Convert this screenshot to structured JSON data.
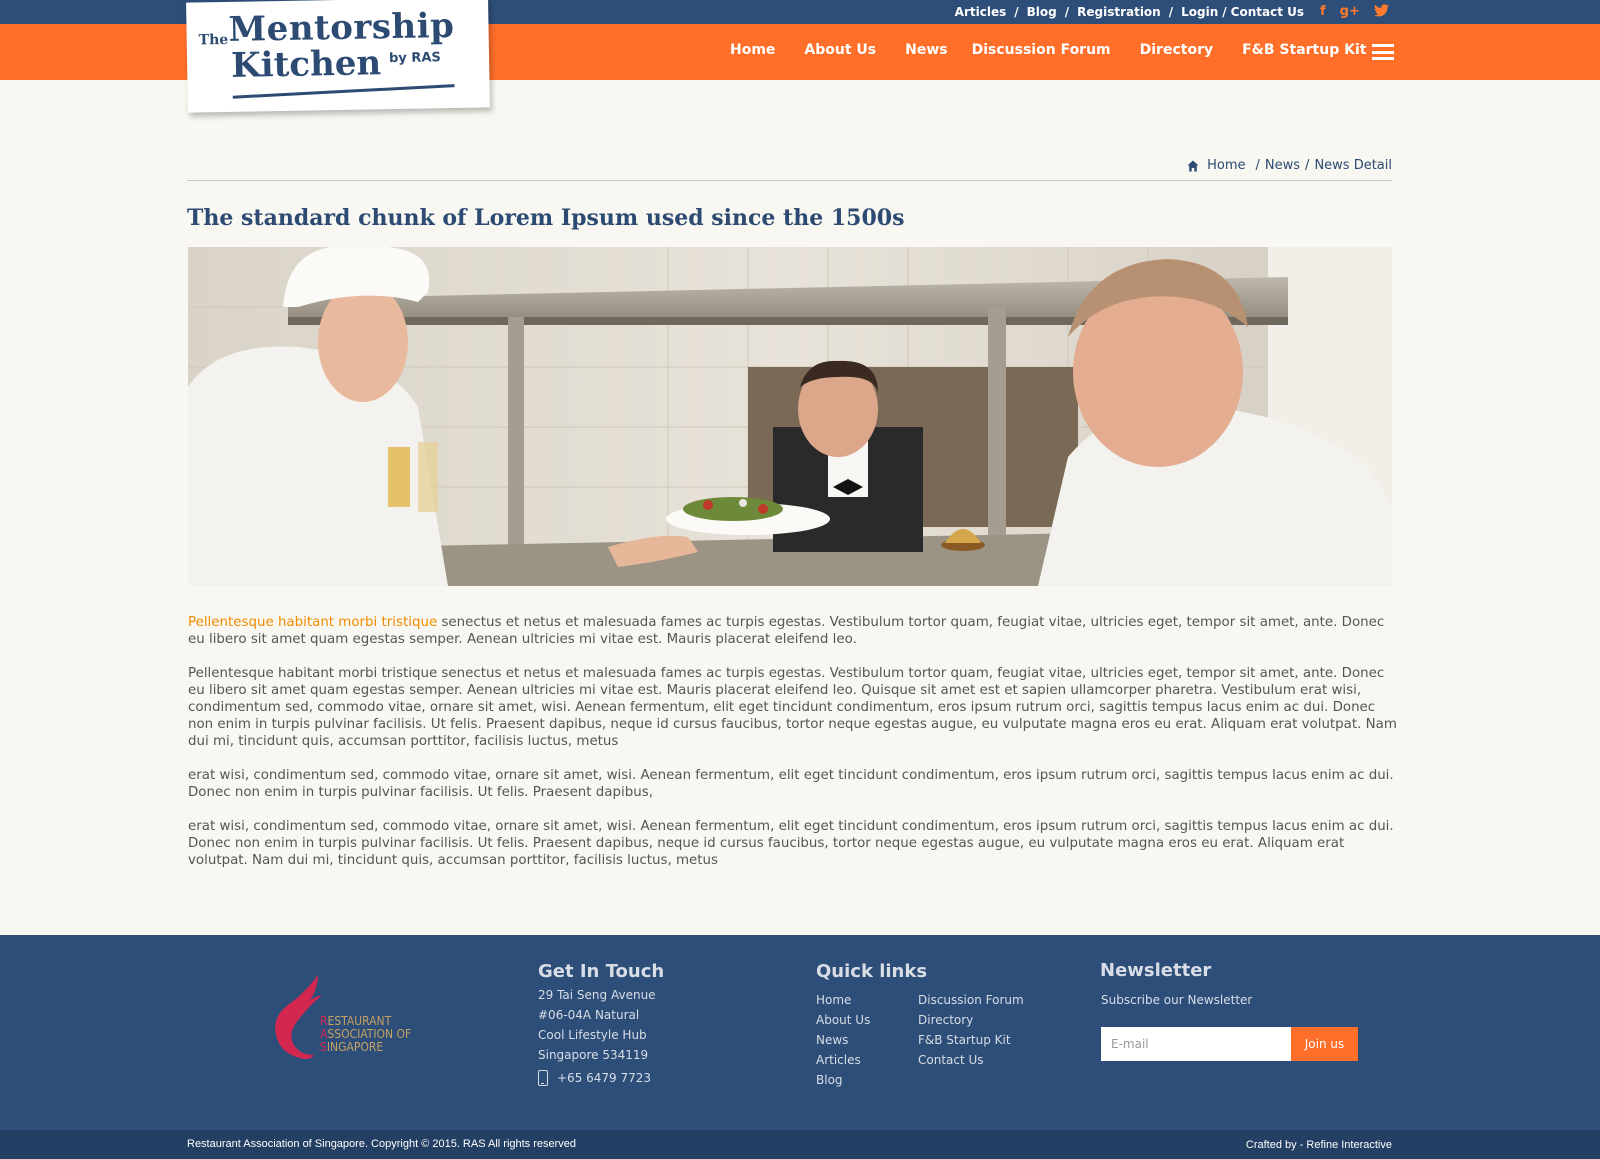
{
  "topbar": {
    "links": [
      "Articles",
      "Blog",
      "Registration",
      "Login",
      "Contact Us"
    ],
    "social": [
      {
        "icon": "facebook-icon",
        "glyph": "f"
      },
      {
        "icon": "google-plus-icon",
        "glyph": "g+"
      },
      {
        "icon": "twitter-icon",
        "glyph": "t"
      }
    ]
  },
  "logo": {
    "the": "The",
    "line1": "Mentorship",
    "line2": "Kitchen",
    "by": "by RAS"
  },
  "nav": {
    "items": [
      "Home",
      "About Us",
      "News",
      "Discussion Forum",
      "Directory",
      "F&B Startup Kit"
    ],
    "menu_icon": "hamburger-menu-icon"
  },
  "breadcrumb": {
    "home": "Home",
    "news": "News",
    "current": "News Detail"
  },
  "article": {
    "title": "The standard chunk of Lorem Ipsum used since the 1500s",
    "lead": "Pellentesque habitant morbi tristique",
    "p1_rest": " senectus et netus et malesuada fames ac turpis egestas. Vestibulum tortor quam, feugiat vitae, ultricies eget, tempor sit amet, ante. Donec eu libero sit amet quam egestas semper. Aenean ultricies mi vitae est. Mauris placerat eleifend leo.",
    "p2": "Pellentesque habitant morbi tristique senectus et netus et malesuada fames ac turpis egestas. Vestibulum tortor quam, feugiat vitae, ultricies eget, tempor sit amet, ante. Donec eu libero sit amet quam egestas semper. Aenean ultricies mi vitae est. Mauris placerat eleifend leo. Quisque sit amet est et sapien ullamcorper pharetra. Vestibulum erat wisi, condimentum sed, commodo vitae, ornare sit amet, wisi. Aenean fermentum, elit eget tincidunt condimentum, eros ipsum rutrum orci, sagittis tempus lacus enim ac dui. Donec non enim in turpis pulvinar facilisis. Ut felis. Praesent dapibus, neque id cursus faucibus, tortor neque egestas augue, eu vulputate magna eros eu erat. Aliquam erat volutpat. Nam dui mi, tincidunt quis, accumsan porttitor, facilisis luctus, metus",
    "p3": "erat wisi, condimentum sed, commodo vitae, ornare sit amet, wisi. Aenean fermentum, elit eget tincidunt condimentum, eros ipsum rutrum orci, sagittis tempus lacus enim ac dui. Donec non enim in turpis pulvinar facilisis. Ut felis. Praesent dapibus,",
    "p4": "erat wisi, condimentum sed, commodo vitae, ornare sit amet, wisi. Aenean fermentum, elit eget tincidunt condimentum, eros ipsum rutrum orci, sagittis tempus lacus enim ac dui. Donec non enim in turpis pulvinar facilisis. Ut felis. Praesent dapibus, neque id cursus faucibus, tortor neque egestas augue, eu vulputate magna eros eu erat. Aliquam erat volutpat. Nam dui mi, tincidunt quis, accumsan porttitor, facilisis luctus, metus"
  },
  "footer": {
    "ras_logo": {
      "line1_initial": "R",
      "line1_rest": "ESTAURANT",
      "line2_initial": "A",
      "line2_rest": "SSOCIATION OF",
      "line3_initial": "S",
      "line3_rest": "INGAPORE"
    },
    "contact": {
      "heading": "Get In Touch",
      "address": [
        "29 Tai Seng Avenue",
        "#06-04A Natural",
        "Cool Lifestyle Hub",
        "Singapore 534119"
      ],
      "phone": "+65 6479 7723"
    },
    "quicklinks": {
      "heading": "Quick links",
      "col1": [
        "Home",
        "About Us",
        "News",
        "Articles",
        "Blog"
      ],
      "col2": [
        "Discussion Forum",
        "Directory",
        "F&B Startup Kit",
        "Contact Us"
      ]
    },
    "newsletter": {
      "heading": "Newsletter",
      "subtitle": "Subscribe our Newsletter",
      "placeholder": "E-mail",
      "button": "Join us"
    },
    "copyright": "Restaurant Association of Singapore. Copyright © 2015. RAS All rights reserved",
    "crafted": "Crafted by - Refine Interactive"
  },
  "colors": {
    "navy": "#2d4e78",
    "orange": "#ff6f2a",
    "background": "#f8f7f1",
    "lead_text": "#f08c00"
  }
}
